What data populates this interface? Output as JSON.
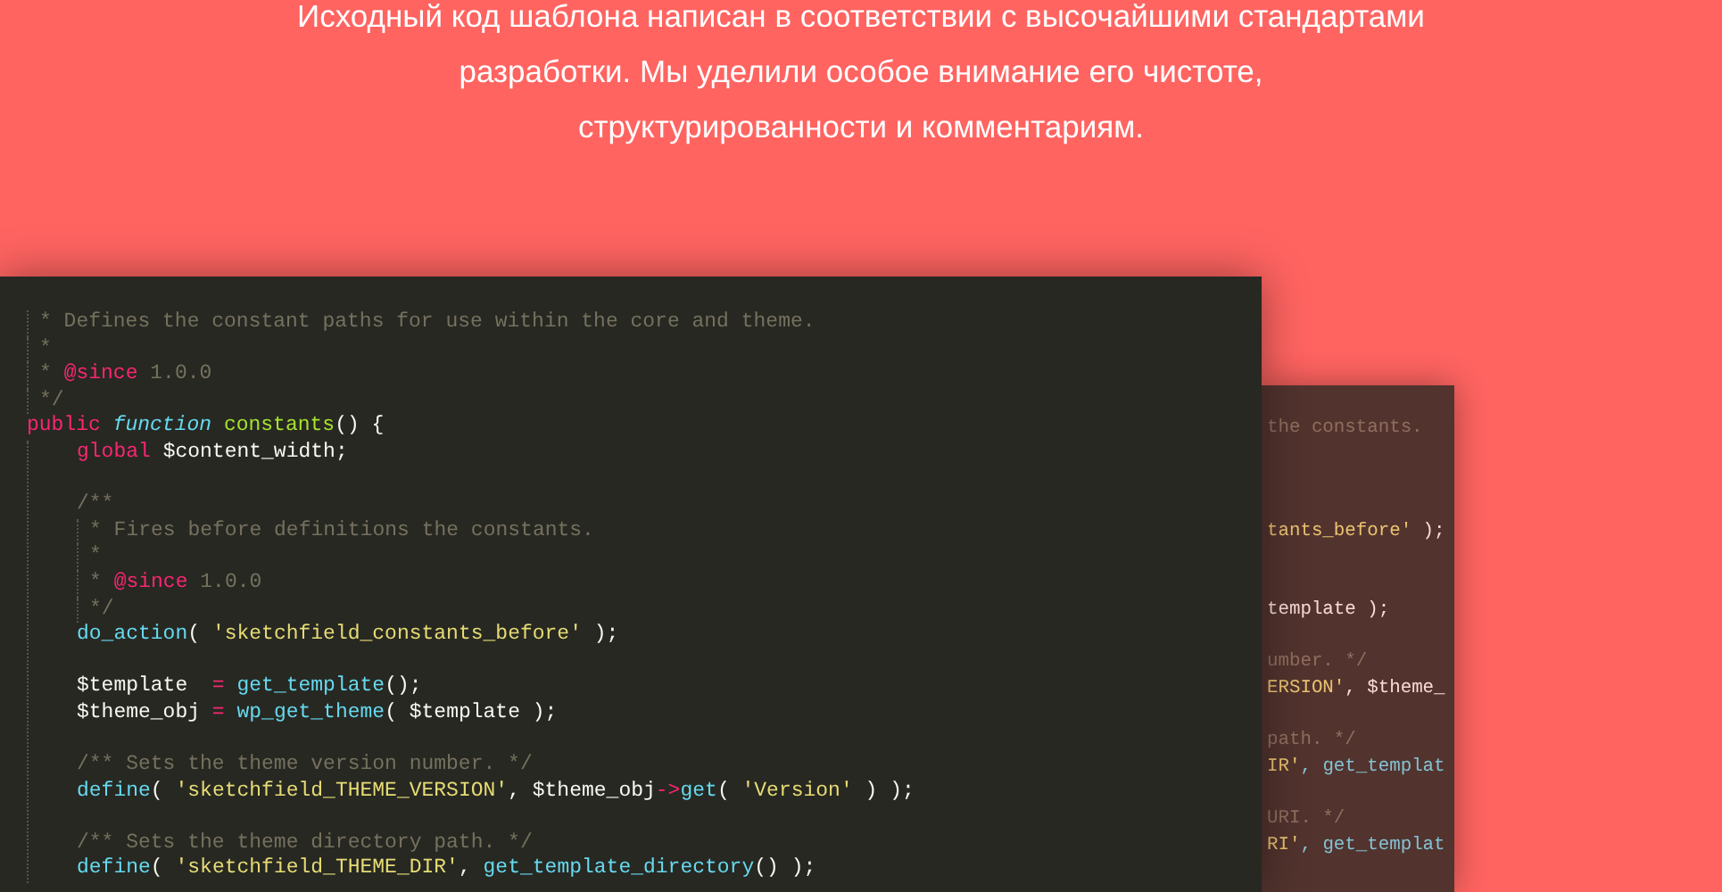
{
  "intro": {
    "lines": [
      "Исходный код шаблона написан в соответствии с высочайшими стандартами",
      "разработки. Мы уделили особое внимание его чистоте,",
      "структурированности и комментариям."
    ]
  },
  "code_front": {
    "lines": [
      {
        "kind": "doc",
        "tokens": [
          {
            "text": "* Defines the constant paths for use within the core and theme.",
            "kind": "comment"
          }
        ]
      },
      {
        "kind": "doc",
        "tokens": [
          {
            "text": "*",
            "kind": "comment"
          }
        ]
      },
      {
        "kind": "doc",
        "tokens": [
          {
            "text": "* ",
            "kind": "comment"
          },
          {
            "text": "@since",
            "kind": "keyword"
          },
          {
            "text": " 1.0.0",
            "kind": "comment"
          }
        ]
      },
      {
        "kind": "doc",
        "tokens": [
          {
            "text": "*/",
            "kind": "comment"
          }
        ]
      },
      {
        "kind": "code",
        "tokens": [
          {
            "text": "public",
            "kind": "keyword"
          },
          {
            "text": " function",
            "kind": "storage"
          },
          {
            "text": " constants",
            "kind": "func"
          },
          {
            "text": "() {",
            "kind": "plain"
          }
        ],
        "children": [
          {
            "kind": "code",
            "tokens": [
              {
                "text": "global",
                "kind": "keyword"
              },
              {
                "text": " $content_width;",
                "kind": "plain"
              }
            ]
          },
          {
            "kind": "blank"
          },
          {
            "kind": "code",
            "tokens": [
              {
                "text": "/**",
                "kind": "comment"
              }
            ]
          },
          {
            "kind": "doc",
            "tokens": [
              {
                "text": "* Fires before definitions the constants.",
                "kind": "comment"
              }
            ]
          },
          {
            "kind": "doc",
            "tokens": [
              {
                "text": "*",
                "kind": "comment"
              }
            ]
          },
          {
            "kind": "doc",
            "tokens": [
              {
                "text": "* ",
                "kind": "comment"
              },
              {
                "text": "@since",
                "kind": "keyword"
              },
              {
                "text": " 1.0.0",
                "kind": "comment"
              }
            ]
          },
          {
            "kind": "doc",
            "tokens": [
              {
                "text": "*/",
                "kind": "comment"
              }
            ]
          },
          {
            "kind": "code",
            "tokens": [
              {
                "text": "do_action",
                "kind": "call"
              },
              {
                "text": "( ",
                "kind": "plain"
              },
              {
                "text": "'sketchfield_constants_before'",
                "kind": "string"
              },
              {
                "text": " );",
                "kind": "plain"
              }
            ]
          },
          {
            "kind": "blank"
          },
          {
            "kind": "code",
            "tokens": [
              {
                "text": "$template  ",
                "kind": "plain"
              },
              {
                "text": "= ",
                "kind": "keyword"
              },
              {
                "text": "get_template",
                "kind": "call"
              },
              {
                "text": "();",
                "kind": "plain"
              }
            ]
          },
          {
            "kind": "code",
            "tokens": [
              {
                "text": "$theme_obj ",
                "kind": "plain"
              },
              {
                "text": "= ",
                "kind": "keyword"
              },
              {
                "text": "wp_get_theme",
                "kind": "call"
              },
              {
                "text": "( $template );",
                "kind": "plain"
              }
            ]
          },
          {
            "kind": "blank"
          },
          {
            "kind": "code",
            "tokens": [
              {
                "text": "/** Sets the theme version number. */",
                "kind": "comment"
              }
            ]
          },
          {
            "kind": "code",
            "tokens": [
              {
                "text": "define",
                "kind": "call"
              },
              {
                "text": "( ",
                "kind": "plain"
              },
              {
                "text": "'sketchfield_THEME_VERSION'",
                "kind": "string"
              },
              {
                "text": ", $theme_obj",
                "kind": "plain"
              },
              {
                "text": "->",
                "kind": "keyword"
              },
              {
                "text": "get",
                "kind": "call"
              },
              {
                "text": "( ",
                "kind": "plain"
              },
              {
                "text": "'Version'",
                "kind": "string"
              },
              {
                "text": " ) );",
                "kind": "plain"
              }
            ]
          },
          {
            "kind": "blank"
          },
          {
            "kind": "code",
            "tokens": [
              {
                "text": "/** Sets the theme directory path. */",
                "kind": "comment"
              }
            ]
          },
          {
            "kind": "code",
            "tokens": [
              {
                "text": "define",
                "kind": "call"
              },
              {
                "text": "( ",
                "kind": "plain"
              },
              {
                "text": "'sketchfield_THEME_DIR'",
                "kind": "string"
              },
              {
                "text": ", ",
                "kind": "plain"
              },
              {
                "text": "get_template_directory",
                "kind": "call"
              },
              {
                "text": "() );",
                "kind": "plain"
              }
            ]
          }
        ]
      }
    ]
  },
  "code_back": {
    "lines": [
      {
        "kind": "code",
        "tokens": [
          {
            "text": "the constants.",
            "kind": "comment"
          }
        ]
      },
      {
        "kind": "blank"
      },
      {
        "kind": "blank"
      },
      {
        "kind": "blank"
      },
      {
        "kind": "code",
        "tokens": [
          {
            "text": "tants_before'",
            "kind": "string"
          },
          {
            "text": " );",
            "kind": "plain"
          }
        ]
      },
      {
        "kind": "blank"
      },
      {
        "kind": "blank"
      },
      {
        "kind": "code",
        "tokens": [
          {
            "text": "template );",
            "kind": "plain"
          }
        ]
      },
      {
        "kind": "blank"
      },
      {
        "kind": "code",
        "tokens": [
          {
            "text": "umber. */",
            "kind": "comment"
          }
        ]
      },
      {
        "kind": "code",
        "tokens": [
          {
            "text": "ERSION'",
            "kind": "string"
          },
          {
            "text": ", $theme_",
            "kind": "plain"
          }
        ]
      },
      {
        "kind": "blank"
      },
      {
        "kind": "code",
        "tokens": [
          {
            "text": "path. */",
            "kind": "comment"
          }
        ]
      },
      {
        "kind": "code",
        "tokens": [
          {
            "text": "IR'",
            "kind": "string"
          },
          {
            "text": ", get_templat",
            "kind": "call"
          }
        ]
      },
      {
        "kind": "blank"
      },
      {
        "kind": "code",
        "tokens": [
          {
            "text": "URI. */",
            "kind": "comment"
          }
        ]
      },
      {
        "kind": "code",
        "tokens": [
          {
            "text": "RI'",
            "kind": "string"
          },
          {
            "text": ", get_templat",
            "kind": "call"
          }
        ]
      }
    ]
  }
}
